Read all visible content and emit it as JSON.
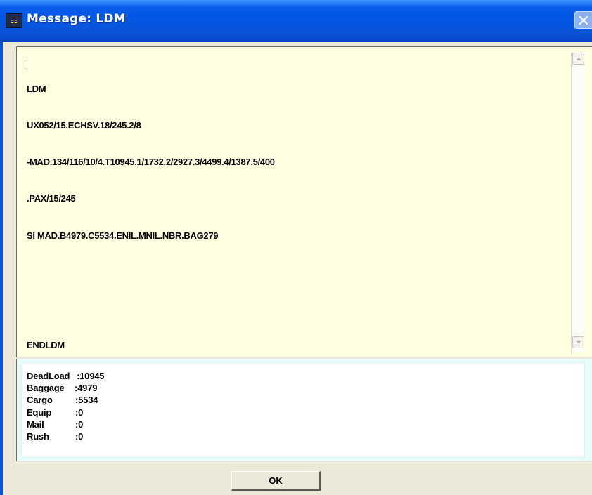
{
  "window": {
    "title": "Message: LDM",
    "icon": "app-icon",
    "title_color": "#ffffff",
    "titlebar_color": "#0a53d8"
  },
  "message": {
    "lines": [
      "LDM",
      "UX052/15.ECHSV.18/245.2/8",
      "-MAD.134/116/10/4.T10945.1/1732.2/2927.3/4499.4/1387.5/400",
      ".PAX/15/245",
      "SI MAD.B4979.C5534.ENIL.MNIL.NBR.BAG279",
      "",
      "",
      "ENDLDM"
    ],
    "background": "#ffffe2"
  },
  "summary": {
    "rows": [
      {
        "label": "DeadLoad",
        "value": ":10945"
      },
      {
        "label": "Baggage",
        "value": ":4979"
      },
      {
        "label": "Cargo",
        "value": ":5534"
      },
      {
        "label": "Equip",
        "value": ":0"
      },
      {
        "label": "Mail",
        "value": ":0"
      },
      {
        "label": "Rush",
        "value": ":0"
      }
    ],
    "background": "#e8fcfc"
  },
  "buttons": {
    "ok_label": "OK"
  },
  "icons": {
    "close": "close-icon",
    "scroll_up": "scroll-up-arrow-icon",
    "scroll_down": "scroll-down-arrow-icon"
  }
}
